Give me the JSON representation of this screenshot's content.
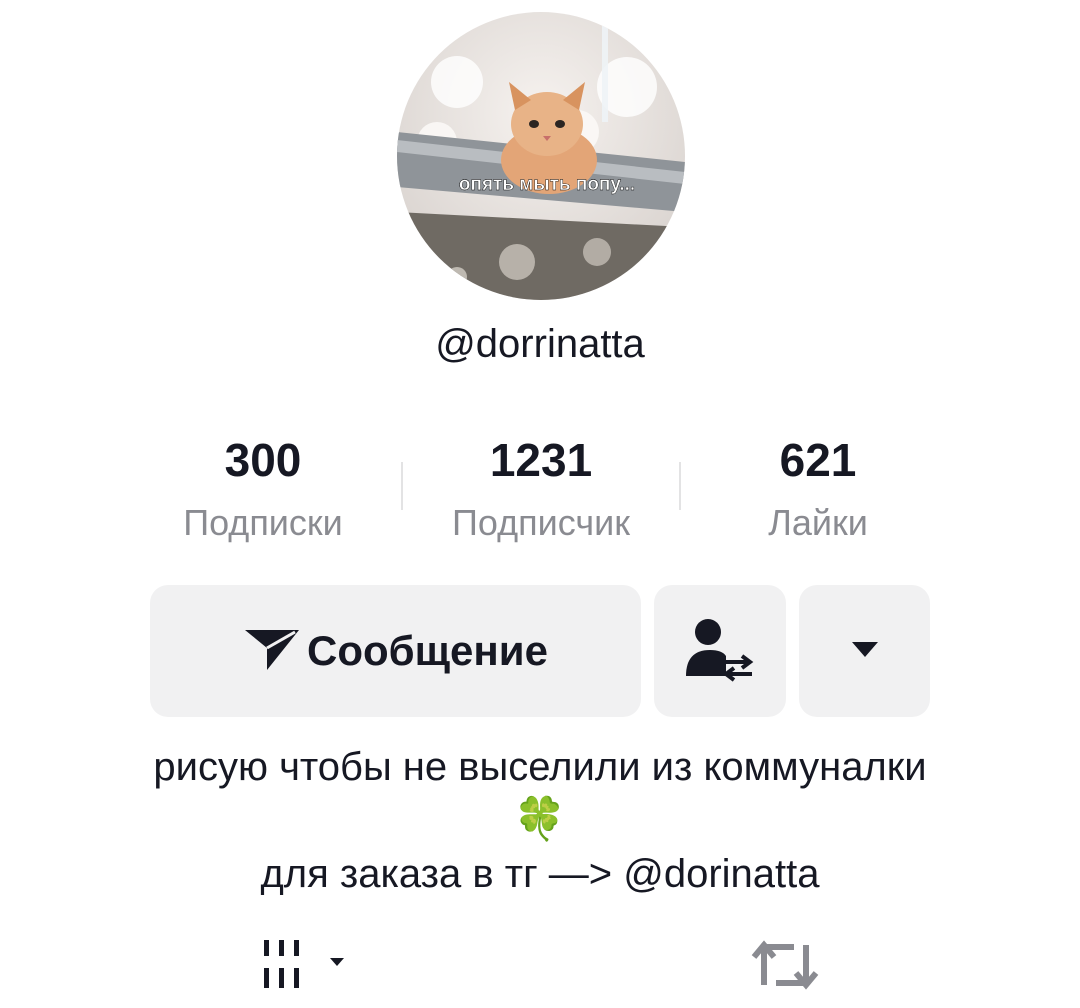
{
  "profile": {
    "avatar_caption": "опять мыть попу...",
    "username": "@dorrinatta"
  },
  "stats": [
    {
      "value": "300",
      "label": "Подписки"
    },
    {
      "value": "1231",
      "label": "Подписчик"
    },
    {
      "value": "621",
      "label": "Лайки"
    }
  ],
  "actions": {
    "message_label": "Сообщение",
    "message_icon": "send-icon",
    "follow_icon": "add-friend-switch-icon",
    "more_icon": "caret-down-icon"
  },
  "bio": {
    "line1": "рисую чтобы не выселили из коммуналки",
    "emoji": "🍀",
    "line2": "для заказа в тг —> @dorinatta"
  },
  "tabs": [
    {
      "icon": "grid-icon"
    },
    {
      "icon": "repost-icon"
    }
  ]
}
